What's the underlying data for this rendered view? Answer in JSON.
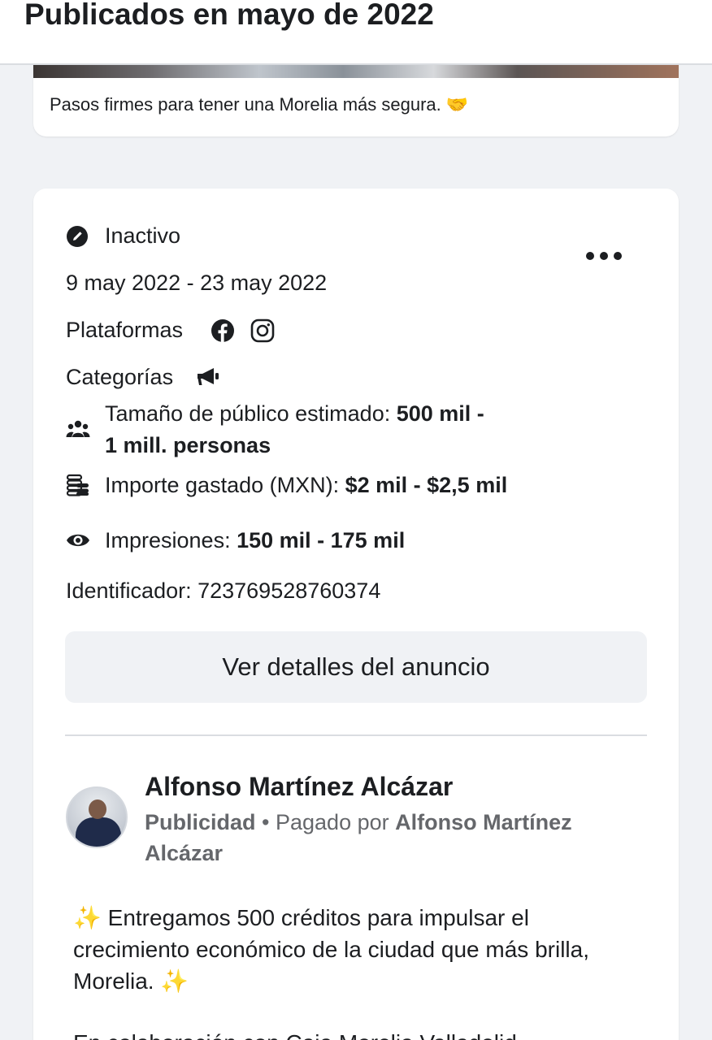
{
  "header": {
    "title": "Publicados en mayo de 2022"
  },
  "previous_ad": {
    "caption": "Pasos firmes para tener una Morelia más segura. 🤝"
  },
  "ad_card": {
    "status": "Inactivo",
    "date_range": "9 may 2022 - 23 may 2022",
    "platforms_label": "Plataformas",
    "categories_label": "Categorías",
    "audience_label": "Tamaño de público estimado: ",
    "audience_value_line1": "500 mil -",
    "audience_value_line2": "1 mill. personas",
    "spend_label": "Importe gastado (MXN): ",
    "spend_value": "$2 mil - $2,5 mil",
    "impressions_label": "Impresiones: ",
    "impressions_value": "150 mil - 175 mil",
    "id_label": "Identificador: 723769528760374",
    "details_button": "Ver detalles del anuncio"
  },
  "advertiser": {
    "name": "Alfonso Martínez Alcázar",
    "sponsored": "Publicidad",
    "separator": " • ",
    "paid_by_label": "Pagado por ",
    "paid_by_name": "Alfonso Martínez Alcázar"
  },
  "ad_text": {
    "line1": "Entregamos 500 créditos para impulsar el crecimiento económico de la ciudad que más brilla, Morelia.",
    "sparkle": "✨",
    "line2": "En colaboración con Caja Morelia Valladolid"
  },
  "icons": {
    "status": "inactive-pencil-icon",
    "more": "more-options-icon",
    "facebook": "facebook-icon",
    "instagram": "instagram-icon",
    "category": "megaphone-icon",
    "audience": "people-icon",
    "spend": "money-stack-icon",
    "impressions": "eye-icon"
  },
  "colors": {
    "text": "#1c1e21",
    "secondary": "#65676b",
    "background": "#f0f2f5",
    "card": "#ffffff"
  }
}
